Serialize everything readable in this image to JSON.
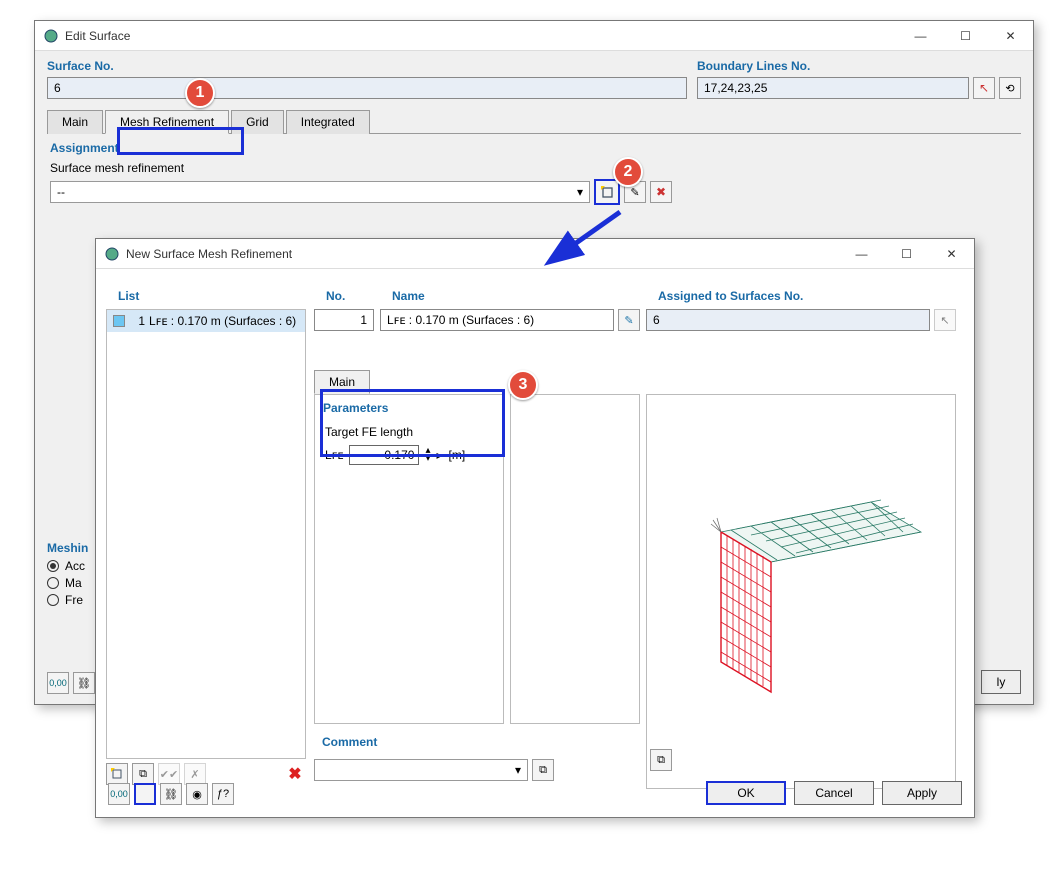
{
  "window1": {
    "title": "Edit Surface",
    "surface_no_label": "Surface No.",
    "surface_no_value": "6",
    "boundary_label": "Boundary Lines No.",
    "boundary_value": "17,24,23,25",
    "tabs": {
      "t0": "Main",
      "t1": "Mesh Refinement",
      "t2": "Grid",
      "t3": "Integrated"
    },
    "assignment_label": "Assignment",
    "surface_mesh_ref_label": "Surface mesh refinement",
    "dropdown_value": "--",
    "meshing_label": "Meshin",
    "radio_acc": "Acc",
    "radio_ma": "Ma",
    "radio_fre": "Fre",
    "apply_parent": "ly"
  },
  "window2": {
    "title": "New Surface Mesh Refinement",
    "list_label": "List",
    "list_item_index": "1",
    "list_item_text": "Lꜰᴇ : 0.170 m (Surfaces : 6)",
    "no_label": "No.",
    "no_value": "1",
    "name_label": "Name",
    "name_value": "Lꜰᴇ : 0.170 m (Surfaces : 6)",
    "assigned_label": "Assigned to Surfaces No.",
    "assigned_value": "6",
    "tab_main": "Main",
    "params_label": "Parameters",
    "target_fe_label": "Target FE length",
    "lfe_label": "Lꜰᴇ",
    "lfe_value": "0.170",
    "lfe_unit": "[m]",
    "comment_label": "Comment",
    "btn_ok": "OK",
    "btn_cancel": "Cancel",
    "btn_apply": "Apply"
  },
  "badges": {
    "b1": "1",
    "b2": "2",
    "b3": "3"
  },
  "icons": {
    "pick": "↖",
    "loop": "⟲",
    "new": "☐*",
    "edit": "✎",
    "del": "✖",
    "chevron": "▾",
    "spin": "⇅",
    "play": "▸"
  }
}
